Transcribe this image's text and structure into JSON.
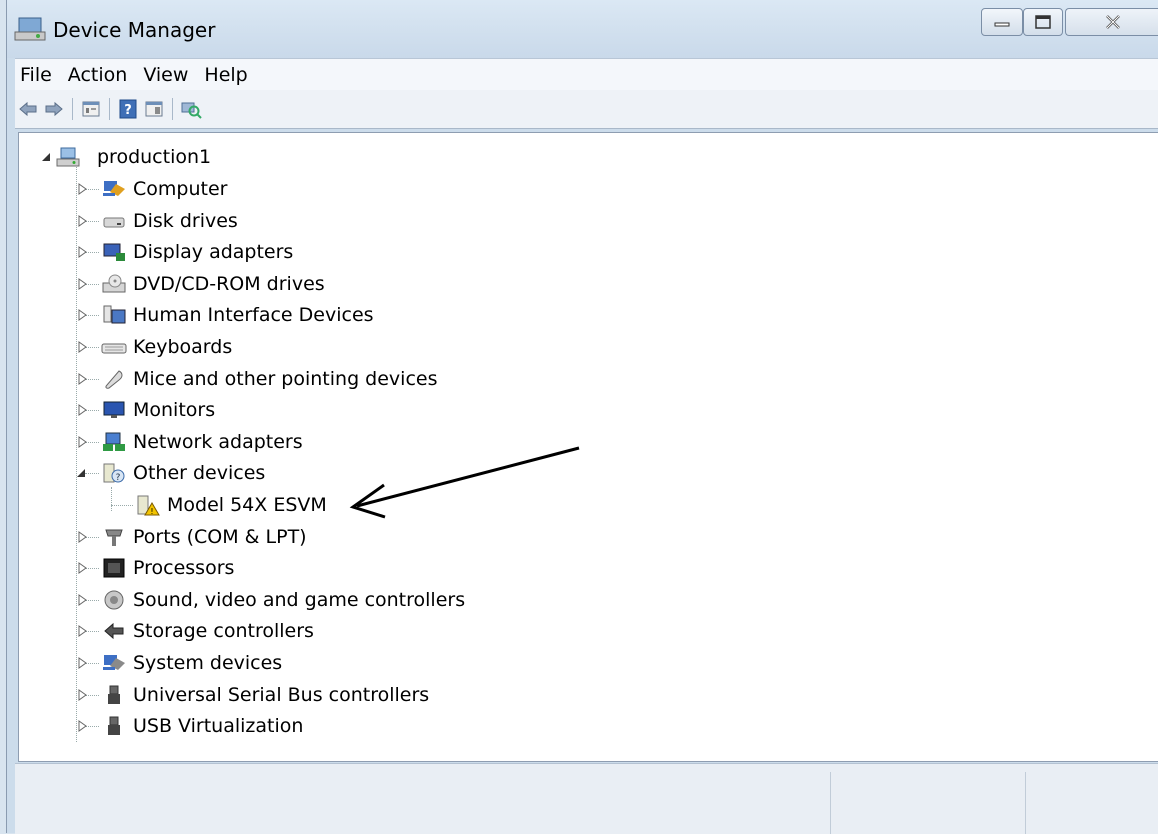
{
  "window": {
    "title": "Device Manager"
  },
  "menu": [
    "File",
    "Action",
    "View",
    "Help"
  ],
  "toolbar": {
    "icons": [
      "back-arrow-icon",
      "forward-arrow-icon",
      "properties-icon",
      "help-icon",
      "details-icon",
      "scan-hardware-icon"
    ]
  },
  "tree": {
    "root": "production1",
    "categories": [
      {
        "label": "Computer",
        "icon": "computer-icon",
        "expanded": false
      },
      {
        "label": "Disk drives",
        "icon": "disk-drive-icon",
        "expanded": false
      },
      {
        "label": "Display adapters",
        "icon": "display-adapter-icon",
        "expanded": false
      },
      {
        "label": "DVD/CD-ROM drives",
        "icon": "dvd-drive-icon",
        "expanded": false
      },
      {
        "label": "Human Interface Devices",
        "icon": "hid-icon",
        "expanded": false
      },
      {
        "label": "Keyboards",
        "icon": "keyboard-icon",
        "expanded": false
      },
      {
        "label": "Mice and other pointing devices",
        "icon": "mouse-icon",
        "expanded": false
      },
      {
        "label": "Monitors",
        "icon": "monitor-icon",
        "expanded": false
      },
      {
        "label": "Network adapters",
        "icon": "network-adapter-icon",
        "expanded": false
      },
      {
        "label": "Other devices",
        "icon": "unknown-device-icon",
        "expanded": true,
        "children": [
          {
            "label": "Model 54X ESVM",
            "icon": "warning-device-icon"
          }
        ]
      },
      {
        "label": "Ports (COM & LPT)",
        "icon": "port-icon",
        "expanded": false
      },
      {
        "label": "Processors",
        "icon": "processor-icon",
        "expanded": false
      },
      {
        "label": "Sound, video and game controllers",
        "icon": "sound-icon",
        "expanded": false
      },
      {
        "label": "Storage controllers",
        "icon": "storage-controller-icon",
        "expanded": false
      },
      {
        "label": "System devices",
        "icon": "system-device-icon",
        "expanded": false
      },
      {
        "label": "Universal Serial Bus controllers",
        "icon": "usb-icon",
        "expanded": false
      },
      {
        "label": "USB Virtualization",
        "icon": "usb-icon",
        "expanded": false
      }
    ]
  },
  "colors": {
    "arrow": "#000000",
    "titlebar": "#d3e1ef",
    "window": "#ccdceb"
  }
}
